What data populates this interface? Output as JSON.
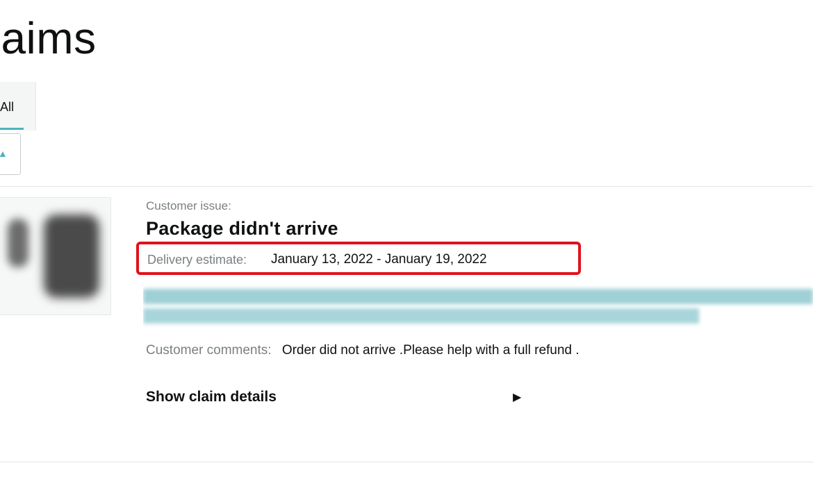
{
  "header": {
    "title": "Claims"
  },
  "tabs": [
    {
      "label": "All",
      "active": true
    }
  ],
  "filter": {
    "caret_icon": "chevron-up-icon"
  },
  "claim": {
    "issue_label": "Customer issue:",
    "issue_title": "Package didn't arrive",
    "delivery_estimate_label": "Delivery estimate:",
    "delivery_estimate_value": "January 13, 2022 - January 19, 2022",
    "comments_label": "Customer comments:",
    "comments_value": "Order did not arrive .Please help with a full refund .",
    "show_details_label": "Show claim details",
    "show_details_icon": "caret-right-icon"
  },
  "colors": {
    "highlight_border": "#e0121b",
    "tab_accent": "#4fb3bf",
    "blurred_link": "#9fd0d6"
  }
}
